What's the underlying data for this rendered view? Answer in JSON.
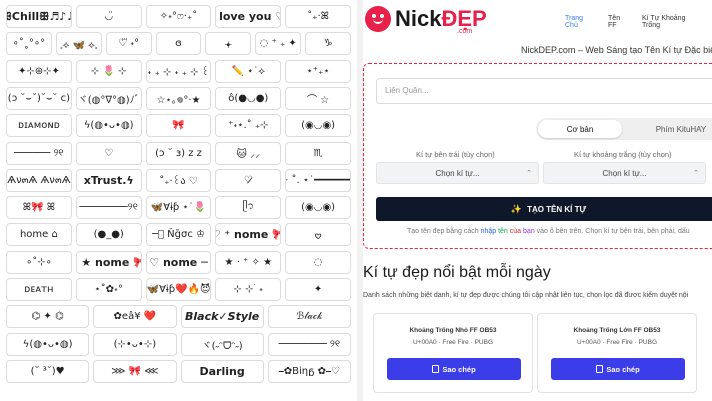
{
  "symbol_grid": {
    "rows": [
      [
        "ꕥChillꕥ♬♪♫",
        "◡̈",
        "✧˖°ෆ‧₊˚",
        "i love you ♡",
        "˚₊‧ꕤ"
      ],
      [
        "∘˚˳°∘°",
        "𓈒⟡ 🦋 ⟡𓈒",
        "♡⃛ ˖°",
        "ɞ",
        "𖥔",
        "◌ ⁺ ₊ ✦",
        "♑"
      ],
      [
        "✦⊹⊛⊹✦",
        "⊹ 🌷 ⊹",
        "˖ ₊ ⊹ ˖ ₊ ⊹ ꒰",
        "✏️ ⋆˙⟡",
        "⋆⁺₊⋆"
      ],
      [
        "(ɔ ˘⌣˘)˘⌣˘ c)",
        "ヾ(◍°∇°◍)ﾉﾞ",
        "☆⋆｡𖦹°‧★",
        "ô(●◡●)",
        "⌒ ☆"
      ],
      [
        "ᴅɪᴀᴍᴏɴᴅ",
        "ϟ(◍•ᴗ•◍)",
        "🎀",
        "⁺˖⋆.˚ ₊⊹",
        "(◉◡◉)"
      ],
      [
        "────── ୨୧",
        "♡",
        "(ɔ ˘ ɜ) z z",
        "🐱 ⸝⸝",
        "♏"
      ],
      [
        "Ѧν๓Ѧ Ѧν๓Ѧ",
        "xTrust.ϟ",
        "˚₊‧꒰ა ♡",
        "♡̷",
        "⊹ ˚. ⋆˙━━━━━━━"
      ],
      [
        "ꕤ🎀 ꕤ",
        "────────୨୧",
        "🦋Ɐɨƥ ⋆˙🌷",
        "ᥫ᭡",
        "(◉◡◉)"
      ],
      [
        "home ⌂",
        "(●_●)",
        "─⃝ Ňḡσc ♔",
        "♡ ⁺ nome 🎀",
        "𖹭"
      ],
      [
        "∘˚⊹∘",
        "⋆ ★ nome 🎀",
        "♡ nome ─",
        "★ · ⁺ ✧ ★",
        "◌"
      ],
      [
        "ᴅᴇᴀᴛʜ",
        "⋆˚✿˖°",
        "🦋Ɐɨƥ❤️🔥😈",
        "⊹ ⊹ ࣪ ˖",
        "✦"
      ],
      [
        "⌬ ✦ ⌬",
        "✿eâ¥ ❤️",
        "Black✓Style",
        "ℬ𝓁𝒶𝒸𝓀"
      ],
      [
        "ϟ(◍•ᴗ•◍)",
        "(⊹•ᴗ•⊹)",
        "ヾ(˶ᵔᗜᵔ˶)",
        "──────── ୨୧"
      ],
      [
        "(˘ ³˘)♥",
        "⋙ 🎀 ⋘",
        "Darling",
        "⎯✿Biηᵷ ✿⎯♡"
      ]
    ]
  },
  "site": {
    "logo": {
      "part1": "Nick",
      "part2": "ĐẸP",
      "sub": ".com"
    },
    "nav": [
      {
        "label": "Trang Chủ",
        "active": true
      },
      {
        "label": "Tên FF",
        "active": false
      },
      {
        "label": "Kí Tự Khoảng Trống",
        "active": false
      }
    ],
    "tagline": "NickDEP.com – Web Sáng tạo Tên Kí tự Đặc biệt Đẹp",
    "form": {
      "input_placeholder": "Liên Quân...",
      "tabs": {
        "basic": "Cơ bản",
        "hay": "Phím KituHAY"
      },
      "left_label": "Kí tự bên trái (tùy chọn)",
      "space_label": "Kí tự khoảng trắng (tùy chọn)",
      "left_select": "Chọn kí tự...",
      "space_select": "Chọn kí tự...",
      "create_button": "TẠO TÊN KÍ TỰ",
      "hint_pre": "Tạo tên đẹp bằng cách ",
      "hint_w1": "nhập",
      "hint_w2": "tên",
      "hint_w3": "của",
      "hint_w4": "bạn",
      "hint_post": " vào ô bên trên. Chọn kí tự bên trái, bên phải, dấu"
    },
    "section": {
      "title": "Kí tự đẹp nổi bật mỗi ngày",
      "desc": "Danh sách những biệt danh, kí tự đẹp được chúng tôi cập nhật liên tục, chọn lọc đã được kiểm duyệt nội"
    },
    "cards": [
      {
        "title": "Khoảng Trống Nhỏ FF OB53",
        "meta": "U+00A0 · Free Fire · PUBG",
        "button": "Sao chép"
      },
      {
        "title": "Khoảng Trống Lớn FF OB53",
        "meta": "U+00A0 · Free Fire · PUBG",
        "button": "Sao chép"
      }
    ],
    "colors": {
      "brand": "#e8214a",
      "nav_active": "#3b82f6",
      "button_dark": "#0f172a",
      "copy_button": "#3b3de8"
    }
  }
}
